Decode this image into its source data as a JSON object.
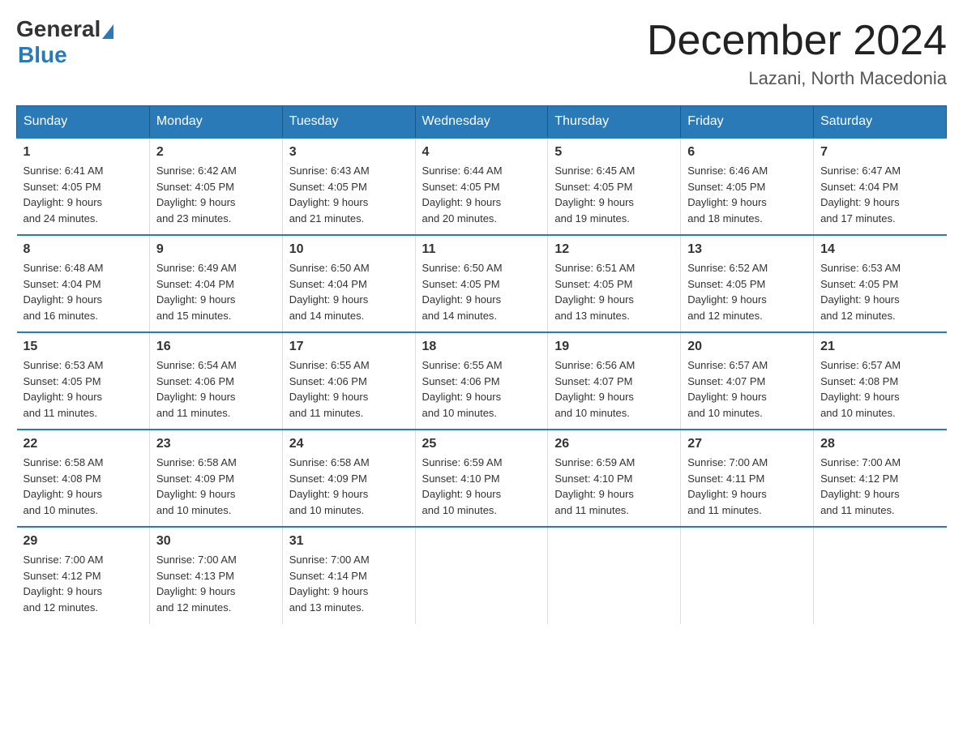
{
  "logo": {
    "general": "General",
    "blue": "Blue"
  },
  "header": {
    "month": "December 2024",
    "location": "Lazani, North Macedonia"
  },
  "weekdays": [
    "Sunday",
    "Monday",
    "Tuesday",
    "Wednesday",
    "Thursday",
    "Friday",
    "Saturday"
  ],
  "weeks": [
    [
      {
        "day": "1",
        "sunrise": "6:41 AM",
        "sunset": "4:05 PM",
        "daylight": "9 hours and 24 minutes."
      },
      {
        "day": "2",
        "sunrise": "6:42 AM",
        "sunset": "4:05 PM",
        "daylight": "9 hours and 23 minutes."
      },
      {
        "day": "3",
        "sunrise": "6:43 AM",
        "sunset": "4:05 PM",
        "daylight": "9 hours and 21 minutes."
      },
      {
        "day": "4",
        "sunrise": "6:44 AM",
        "sunset": "4:05 PM",
        "daylight": "9 hours and 20 minutes."
      },
      {
        "day": "5",
        "sunrise": "6:45 AM",
        "sunset": "4:05 PM",
        "daylight": "9 hours and 19 minutes."
      },
      {
        "day": "6",
        "sunrise": "6:46 AM",
        "sunset": "4:05 PM",
        "daylight": "9 hours and 18 minutes."
      },
      {
        "day": "7",
        "sunrise": "6:47 AM",
        "sunset": "4:04 PM",
        "daylight": "9 hours and 17 minutes."
      }
    ],
    [
      {
        "day": "8",
        "sunrise": "6:48 AM",
        "sunset": "4:04 PM",
        "daylight": "9 hours and 16 minutes."
      },
      {
        "day": "9",
        "sunrise": "6:49 AM",
        "sunset": "4:04 PM",
        "daylight": "9 hours and 15 minutes."
      },
      {
        "day": "10",
        "sunrise": "6:50 AM",
        "sunset": "4:04 PM",
        "daylight": "9 hours and 14 minutes."
      },
      {
        "day": "11",
        "sunrise": "6:50 AM",
        "sunset": "4:05 PM",
        "daylight": "9 hours and 14 minutes."
      },
      {
        "day": "12",
        "sunrise": "6:51 AM",
        "sunset": "4:05 PM",
        "daylight": "9 hours and 13 minutes."
      },
      {
        "day": "13",
        "sunrise": "6:52 AM",
        "sunset": "4:05 PM",
        "daylight": "9 hours and 12 minutes."
      },
      {
        "day": "14",
        "sunrise": "6:53 AM",
        "sunset": "4:05 PM",
        "daylight": "9 hours and 12 minutes."
      }
    ],
    [
      {
        "day": "15",
        "sunrise": "6:53 AM",
        "sunset": "4:05 PM",
        "daylight": "9 hours and 11 minutes."
      },
      {
        "day": "16",
        "sunrise": "6:54 AM",
        "sunset": "4:06 PM",
        "daylight": "9 hours and 11 minutes."
      },
      {
        "day": "17",
        "sunrise": "6:55 AM",
        "sunset": "4:06 PM",
        "daylight": "9 hours and 11 minutes."
      },
      {
        "day": "18",
        "sunrise": "6:55 AM",
        "sunset": "4:06 PM",
        "daylight": "9 hours and 10 minutes."
      },
      {
        "day": "19",
        "sunrise": "6:56 AM",
        "sunset": "4:07 PM",
        "daylight": "9 hours and 10 minutes."
      },
      {
        "day": "20",
        "sunrise": "6:57 AM",
        "sunset": "4:07 PM",
        "daylight": "9 hours and 10 minutes."
      },
      {
        "day": "21",
        "sunrise": "6:57 AM",
        "sunset": "4:08 PM",
        "daylight": "9 hours and 10 minutes."
      }
    ],
    [
      {
        "day": "22",
        "sunrise": "6:58 AM",
        "sunset": "4:08 PM",
        "daylight": "9 hours and 10 minutes."
      },
      {
        "day": "23",
        "sunrise": "6:58 AM",
        "sunset": "4:09 PM",
        "daylight": "9 hours and 10 minutes."
      },
      {
        "day": "24",
        "sunrise": "6:58 AM",
        "sunset": "4:09 PM",
        "daylight": "9 hours and 10 minutes."
      },
      {
        "day": "25",
        "sunrise": "6:59 AM",
        "sunset": "4:10 PM",
        "daylight": "9 hours and 10 minutes."
      },
      {
        "day": "26",
        "sunrise": "6:59 AM",
        "sunset": "4:10 PM",
        "daylight": "9 hours and 11 minutes."
      },
      {
        "day": "27",
        "sunrise": "7:00 AM",
        "sunset": "4:11 PM",
        "daylight": "9 hours and 11 minutes."
      },
      {
        "day": "28",
        "sunrise": "7:00 AM",
        "sunset": "4:12 PM",
        "daylight": "9 hours and 11 minutes."
      }
    ],
    [
      {
        "day": "29",
        "sunrise": "7:00 AM",
        "sunset": "4:12 PM",
        "daylight": "9 hours and 12 minutes."
      },
      {
        "day": "30",
        "sunrise": "7:00 AM",
        "sunset": "4:13 PM",
        "daylight": "9 hours and 12 minutes."
      },
      {
        "day": "31",
        "sunrise": "7:00 AM",
        "sunset": "4:14 PM",
        "daylight": "9 hours and 13 minutes."
      },
      null,
      null,
      null,
      null
    ]
  ],
  "labels": {
    "sunrise": "Sunrise:",
    "sunset": "Sunset:",
    "daylight": "Daylight:"
  }
}
